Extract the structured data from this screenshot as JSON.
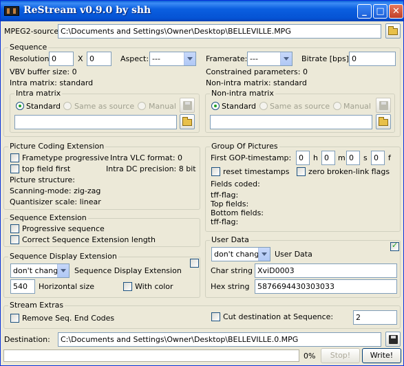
{
  "window": {
    "title": "ReStream v0.9.0 by shh"
  },
  "source": {
    "label": "MPEG2-source:",
    "path": "C:\\Documents and Settings\\Owner\\Desktop\\BELLEVILLE.MPG"
  },
  "sequence": {
    "title": "Sequence",
    "resolution_label": "Resolution:",
    "width": "0",
    "x_label": "X",
    "height": "0",
    "aspect_label": "Aspect:",
    "aspect_value": "---",
    "framerate_label": "Framerate:",
    "framerate_value": "---",
    "bitrate_label": "Bitrate [bps]:",
    "bitrate_value": "0",
    "vbv_text": "VBV buffer size: 0",
    "constrained_text": "Constrained parameters: 0",
    "intra_matrix_text": "Intra matrix: standard",
    "nonintra_matrix_text": "Non-intra matrix: standard",
    "intra_group": {
      "title": "Intra matrix",
      "opt_standard": "Standard",
      "opt_same": "Same as source",
      "opt_manual": "Manual",
      "selected": "standard",
      "file_value": ""
    },
    "nonintra_group": {
      "title": "Non-intra matrix",
      "opt_standard": "Standard",
      "opt_same": "Same as source",
      "opt_manual": "Manual",
      "selected": "standard",
      "file_value": ""
    }
  },
  "picture_coding": {
    "title": "Picture Coding Extension",
    "frametype_label": "Frametype progressive",
    "frametype_checked": false,
    "topfield_label": "top field first",
    "topfield_checked": false,
    "intra_vlc_text": "Intra VLC format: 0",
    "intra_dc_text": "Intra DC precision: 8 bit",
    "picture_structure_text": "Picture structure:",
    "scanning_text": "Scanning-mode: zig-zag",
    "quantiser_text": "Quantisizer scale: linear"
  },
  "gop": {
    "title": "Group Of Pictures",
    "timestamp_label": "First GOP-timestamp:",
    "h": "0",
    "h_unit": "h",
    "m": "0",
    "m_unit": "m",
    "s": "0",
    "s_unit": "s",
    "f": "0",
    "f_unit": "f",
    "reset_label": "reset timestamps",
    "reset_checked": false,
    "zero_label": "zero broken-link flags",
    "zero_checked": false,
    "fields_coded": "Fields coded:",
    "tff_flag_1": "tff-flag:",
    "top_fields": "Top fields:",
    "bottom_fields": "Bottom fields:",
    "tff_flag_2": "tff-flag:"
  },
  "seq_extension": {
    "title": "Sequence Extension",
    "progressive_label": "Progressive sequence",
    "progressive_checked": false,
    "correct_label": "Correct Sequence Extension length",
    "correct_checked": false
  },
  "seq_display": {
    "title": "Sequence Display Extension",
    "combo_value": "don't change",
    "combo_label": "Sequence Display Extension",
    "enabled_checked": false,
    "hsize_value": "540",
    "hsize_label": "Horizontal size",
    "color_label": "With color",
    "color_checked": false
  },
  "user_data": {
    "title": "User Data",
    "combo_value": "don't change",
    "combo_label": "User Data",
    "enabled_checked": true,
    "char_label": "Char string",
    "char_value": "XviD0003",
    "hex_label": "Hex string",
    "hex_value": "5876694430303033"
  },
  "stream_extras": {
    "title": "Stream Extras",
    "remove_label": "Remove Seq. End Codes",
    "remove_checked": false,
    "cut_label": "Cut destination at Sequence:",
    "cut_checked": false,
    "cut_value": "2"
  },
  "destination": {
    "label": "Destination:",
    "path": "C:\\Documents and Settings\\Owner\\Desktop\\BELLEVILLE.0.MPG"
  },
  "footer": {
    "progress_percent": 0,
    "progress_text": "0%",
    "stop_label": "Stop!",
    "write_label": "Write!"
  },
  "icons": {
    "app": "film-reel-icon",
    "open": "folder-open-icon",
    "save": "floppy-disk-icon"
  }
}
